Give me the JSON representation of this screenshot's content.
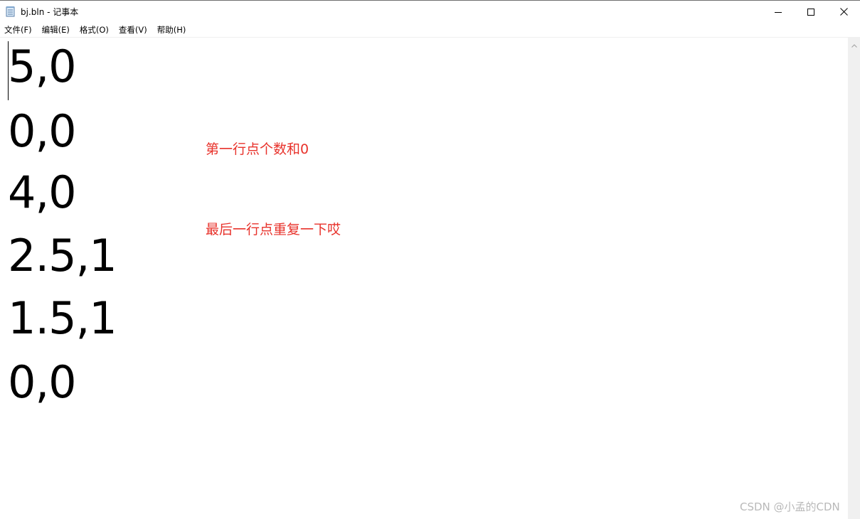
{
  "window": {
    "title": "bj.bln - 记事本"
  },
  "menu": {
    "file": "文件(F)",
    "edit": "编辑(E)",
    "format": "格式(O)",
    "view": "查看(V)",
    "help": "帮助(H)"
  },
  "editor": {
    "lines": [
      "5,0",
      "0,0",
      "4,0",
      "2.5,1",
      "1.5,1",
      "0,0"
    ]
  },
  "annotations": {
    "note1": "第一行点个数和0",
    "note2": "最后一行点重复一下哎",
    "color": "#e8322b"
  },
  "watermark": "CSDN @小孟的CDN",
  "icons": {
    "app": "notepad-icon",
    "minimize": "minimize-icon",
    "maximize": "maximize-icon",
    "close": "close-icon",
    "scroll_up": "chevron-up-icon"
  }
}
